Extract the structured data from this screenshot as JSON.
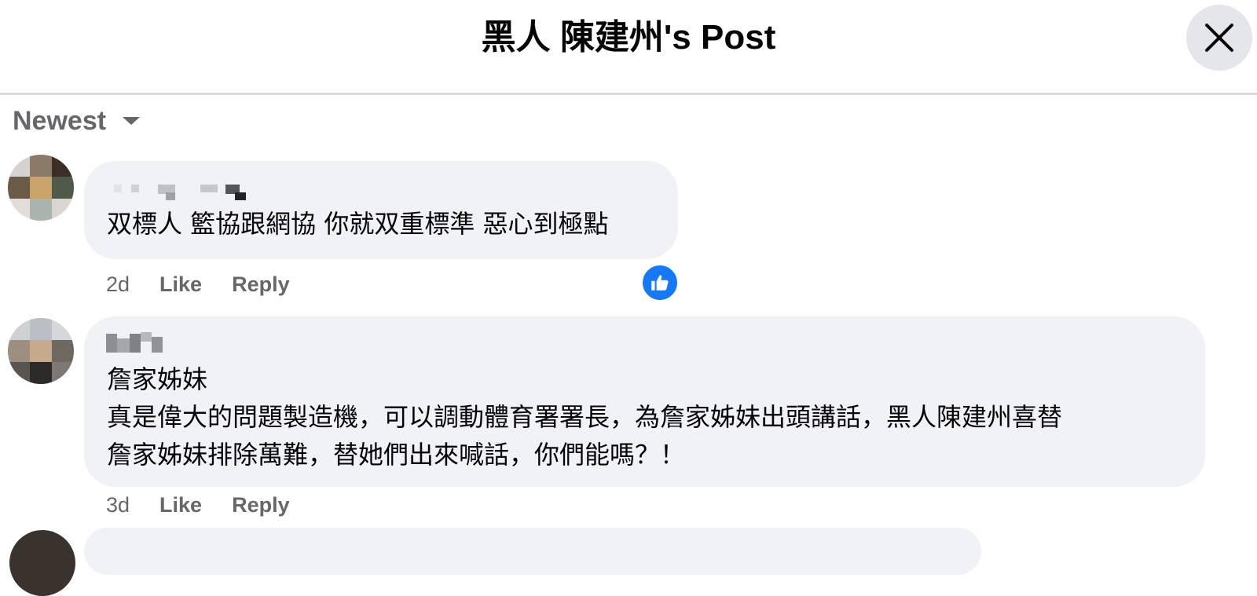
{
  "header": {
    "title": "黑人 陳建州's Post",
    "close_icon": "close-icon"
  },
  "sort": {
    "label": "Newest",
    "icon": "caret-down-icon"
  },
  "comments": [
    {
      "text": "双標人 籃協跟網協 你就双重標準 惡心到極點",
      "time": "2d",
      "like_label": "Like",
      "reply_label": "Reply",
      "reaction": "like-icon",
      "reaction_color": "#1877f2"
    },
    {
      "subtitle": "詹家姊妹",
      "text": "真是偉大的問題製造機，可以調動體育署署長，為詹家姊妹出頭講話，黑人陳建州喜替\n詹家姊妹排除萬難，替她們出來喊話，你們能嗎？！",
      "time": "3d",
      "like_label": "Like",
      "reply_label": "Reply"
    }
  ],
  "colors": {
    "bubble": "#f0f2f5",
    "secondary_text": "#65676b",
    "accent": "#1877f2"
  }
}
